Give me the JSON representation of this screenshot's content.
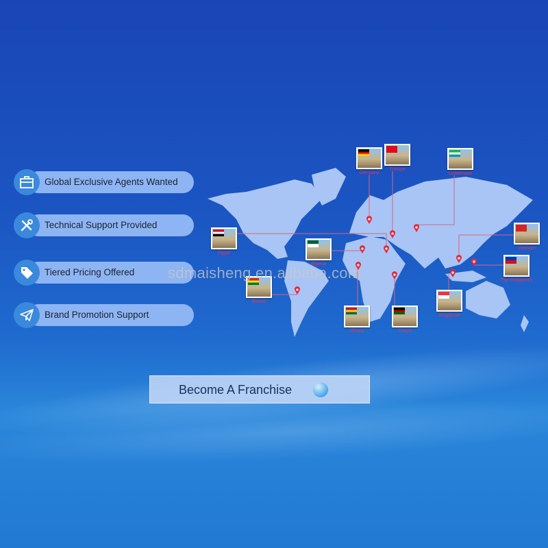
{
  "features": [
    {
      "label": "Global Exclusive Agents Wanted",
      "icon": "briefcase-icon"
    },
    {
      "label": "Technical Support Provided",
      "icon": "tools-icon"
    },
    {
      "label": "Tiered Pricing Offered",
      "icon": "price-tag-icon"
    },
    {
      "label": "Brand Promotion Support",
      "icon": "paper-plane-icon"
    }
  ],
  "locations": [
    {
      "name": "Germany",
      "flag": [
        "#000000",
        "#dd0000",
        "#ffce00"
      ]
    },
    {
      "name": "Türkiye",
      "flag": [
        "#e30a17"
      ]
    },
    {
      "name": "Uzbekistan",
      "flag": [
        "#1eb53a",
        "#ffffff",
        "#0099b5"
      ]
    },
    {
      "name": "Vietnam",
      "flag": [
        "#da251d"
      ]
    },
    {
      "name": "The Philippines",
      "flag": [
        "#0038a8",
        "#ce1126"
      ]
    },
    {
      "name": "Singapore",
      "flag": [
        "#ef3340",
        "#ffffff"
      ]
    },
    {
      "name": "Kenya",
      "flag": [
        "#000000",
        "#bb0000",
        "#006600"
      ]
    },
    {
      "name": "Ghana",
      "flag": [
        "#ce1126",
        "#fcd116",
        "#006b3f"
      ]
    },
    {
      "name": "Egypt",
      "flag": [
        "#ce1126",
        "#ffffff",
        "#000000"
      ]
    },
    {
      "name": "Algeria",
      "flag": [
        "#006233",
        "#ffffff"
      ]
    },
    {
      "name": "Bolivia",
      "flag": [
        "#d52b1e",
        "#f9e300",
        "#007934"
      ]
    }
  ],
  "watermark": "sdmaisheng.en.alibaba.com",
  "cta": {
    "label": "Become A Franchise",
    "icon": "chat-bubble-icon"
  },
  "colors": {
    "pin": "#e8283c",
    "land": "#a8c5f5",
    "pill": "#8eb5f3"
  }
}
